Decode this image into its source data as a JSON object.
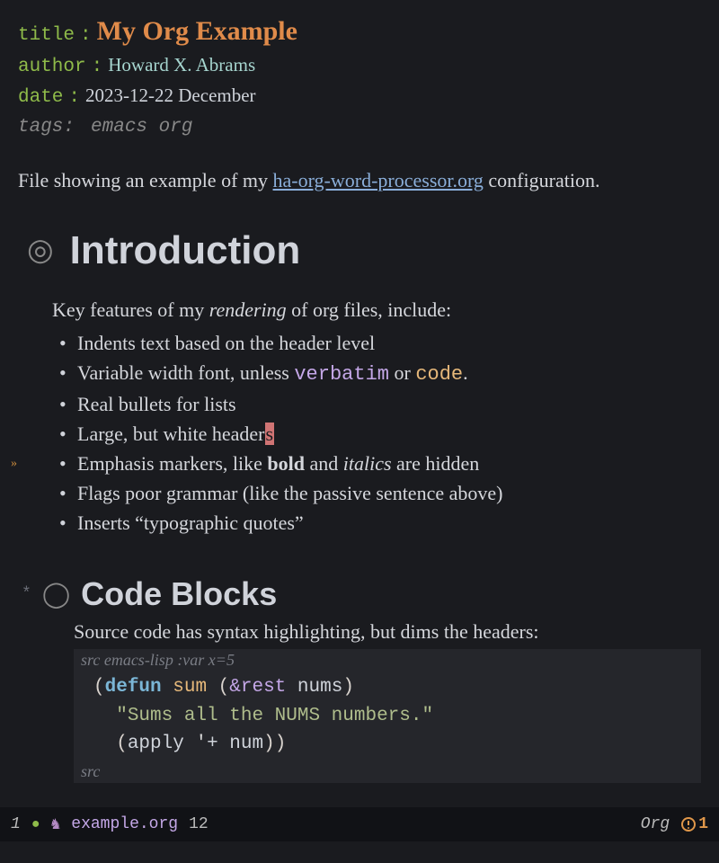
{
  "prolog": {
    "title_key": "title",
    "title_val": "My Org Example",
    "author_key": "author",
    "author_val": "Howard X. Abrams",
    "date_key": "date",
    "date_val": "2023-12-22 December",
    "tags_key": "tags:",
    "tags_val": "emacs org"
  },
  "intro": {
    "pre": "File showing an example of my ",
    "link": "ha-org-word-processor.org",
    "post": " configuration."
  },
  "h1": {
    "bullet": "◎",
    "title": "Introduction",
    "lead_pre": "Key features of my ",
    "lead_em": "rendering",
    "lead_post": " of org files, include:",
    "bullets": {
      "b1": "Indents text based on the header level",
      "b2_pre": "Variable width font, unless ",
      "b2_verbatim": "verbatim",
      "b2_mid": " or ",
      "b2_code": "code",
      "b2_post": ".",
      "b3": "Real bullets for lists",
      "b4_pre": "Large, but white header",
      "b4_cursor": "s",
      "b5_pre": "Emphasis markers, like ",
      "b5_bold": "bold",
      "b5_mid": " and ",
      "b5_it": "italics",
      "b5_post": " are hidden",
      "b6": "Flags poor grammar (like the passive sentence above)",
      "b7": "Inserts “typographic quotes”"
    },
    "fringe": "»"
  },
  "h2": {
    "star": "*",
    "bullet": "◯",
    "title": "Code Blocks",
    "lead": "Source code has syntax highlighting, but dims the headers:",
    "src_header": "src emacs-lisp :var x=5",
    "code": {
      "l1_open": "(",
      "l1_defun": "defun",
      "l1_sp1": " ",
      "l1_name": "sum",
      "l1_sp2": " ",
      "l1_paren2": "(",
      "l1_rest": "&rest",
      "l1_sp3": " ",
      "l1_arg": "nums",
      "l1_close": ")",
      "l2_doc": "\"Sums all the NUMS numbers.\"",
      "l3_open": "(",
      "l3_apply": "apply",
      "l3_sp": " ",
      "l3_q": "'",
      "l3_plus": "+",
      "l3_sp2": " ",
      "l3_num": "num",
      "l3_close": "))"
    },
    "src_footer": "src"
  },
  "modeline": {
    "num": "1",
    "dot": "●",
    "unicorn": "♞",
    "file": "example.org",
    "line": "12",
    "mode": "Org",
    "warn_icon": "ⓘ",
    "warn_count": "1"
  }
}
